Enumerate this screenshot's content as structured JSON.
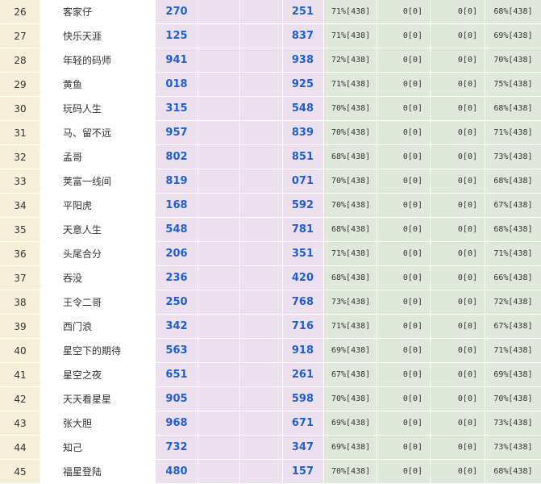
{
  "rows": [
    {
      "rank": "26",
      "name": "客家仔",
      "n1": "270",
      "n2": "251",
      "p1": "71%[438]",
      "z1": "0[0]",
      "z2": "0[0]",
      "p2": "68%[438]"
    },
    {
      "rank": "27",
      "name": "快乐天涯",
      "n1": "125",
      "n2": "837",
      "p1": "71%[438]",
      "z1": "0[0]",
      "z2": "0[0]",
      "p2": "69%[438]"
    },
    {
      "rank": "28",
      "name": "年轻的码师",
      "n1": "941",
      "n2": "938",
      "p1": "72%[438]",
      "z1": "0[0]",
      "z2": "0[0]",
      "p2": "70%[438]"
    },
    {
      "rank": "29",
      "name": "黄鱼",
      "n1": "018",
      "n2": "925",
      "p1": "71%[438]",
      "z1": "0[0]",
      "z2": "0[0]",
      "p2": "75%[438]"
    },
    {
      "rank": "30",
      "name": "玩码人生",
      "n1": "315",
      "n2": "548",
      "p1": "70%[438]",
      "z1": "0[0]",
      "z2": "0[0]",
      "p2": "68%[438]"
    },
    {
      "rank": "31",
      "name": "马、留不远",
      "n1": "957",
      "n2": "839",
      "p1": "70%[438]",
      "z1": "0[0]",
      "z2": "0[0]",
      "p2": "71%[438]"
    },
    {
      "rank": "32",
      "name": "孟哥",
      "n1": "802",
      "n2": "851",
      "p1": "68%[438]",
      "z1": "0[0]",
      "z2": "0[0]",
      "p2": "73%[438]"
    },
    {
      "rank": "33",
      "name": "荚富一线间",
      "n1": "819",
      "n2": "071",
      "p1": "70%[438]",
      "z1": "0[0]",
      "z2": "0[0]",
      "p2": "68%[438]"
    },
    {
      "rank": "34",
      "name": "平阳虎",
      "n1": "168",
      "n2": "592",
      "p1": "70%[438]",
      "z1": "0[0]",
      "z2": "0[0]",
      "p2": "67%[438]"
    },
    {
      "rank": "35",
      "name": "天意人生",
      "n1": "548",
      "n2": "781",
      "p1": "68%[438]",
      "z1": "0[0]",
      "z2": "0[0]",
      "p2": "68%[438]"
    },
    {
      "rank": "36",
      "name": "头尾合分",
      "n1": "206",
      "n2": "351",
      "p1": "71%[438]",
      "z1": "0[0]",
      "z2": "0[0]",
      "p2": "71%[438]"
    },
    {
      "rank": "37",
      "name": "吞没",
      "n1": "236",
      "n2": "420",
      "p1": "68%[438]",
      "z1": "0[0]",
      "z2": "0[0]",
      "p2": "66%[438]"
    },
    {
      "rank": "38",
      "name": "王令二哥",
      "n1": "250",
      "n2": "768",
      "p1": "73%[438]",
      "z1": "0[0]",
      "z2": "0[0]",
      "p2": "72%[438]"
    },
    {
      "rank": "39",
      "name": "西门浪",
      "n1": "342",
      "n2": "716",
      "p1": "71%[438]",
      "z1": "0[0]",
      "z2": "0[0]",
      "p2": "67%[438]"
    },
    {
      "rank": "40",
      "name": "星空下的期待",
      "n1": "563",
      "n2": "918",
      "p1": "69%[438]",
      "z1": "0[0]",
      "z2": "0[0]",
      "p2": "71%[438]"
    },
    {
      "rank": "41",
      "name": "星空之夜",
      "n1": "651",
      "n2": "261",
      "p1": "67%[438]",
      "z1": "0[0]",
      "z2": "0[0]",
      "p2": "69%[438]"
    },
    {
      "rank": "42",
      "name": "天天看星星",
      "n1": "905",
      "n2": "598",
      "p1": "70%[438]",
      "z1": "0[0]",
      "z2": "0[0]",
      "p2": "70%[438]"
    },
    {
      "rank": "43",
      "name": "张大胆",
      "n1": "968",
      "n2": "671",
      "p1": "69%[438]",
      "z1": "0[0]",
      "z2": "0[0]",
      "p2": "73%[438]"
    },
    {
      "rank": "44",
      "name": "知己",
      "n1": "732",
      "n2": "347",
      "p1": "69%[438]",
      "z1": "0[0]",
      "z2": "0[0]",
      "p2": "73%[438]"
    },
    {
      "rank": "45",
      "name": "福星登陆",
      "n1": "480",
      "n2": "157",
      "p1": "70%[438]",
      "z1": "0[0]",
      "z2": "0[0]",
      "p2": "68%[438]"
    }
  ],
  "colors": {
    "rank_bg": "#f6efd9",
    "number_col_bg": "#ece0ef",
    "number_text": "#1f5fd1",
    "stat_col_bg": "#dfe8da"
  }
}
